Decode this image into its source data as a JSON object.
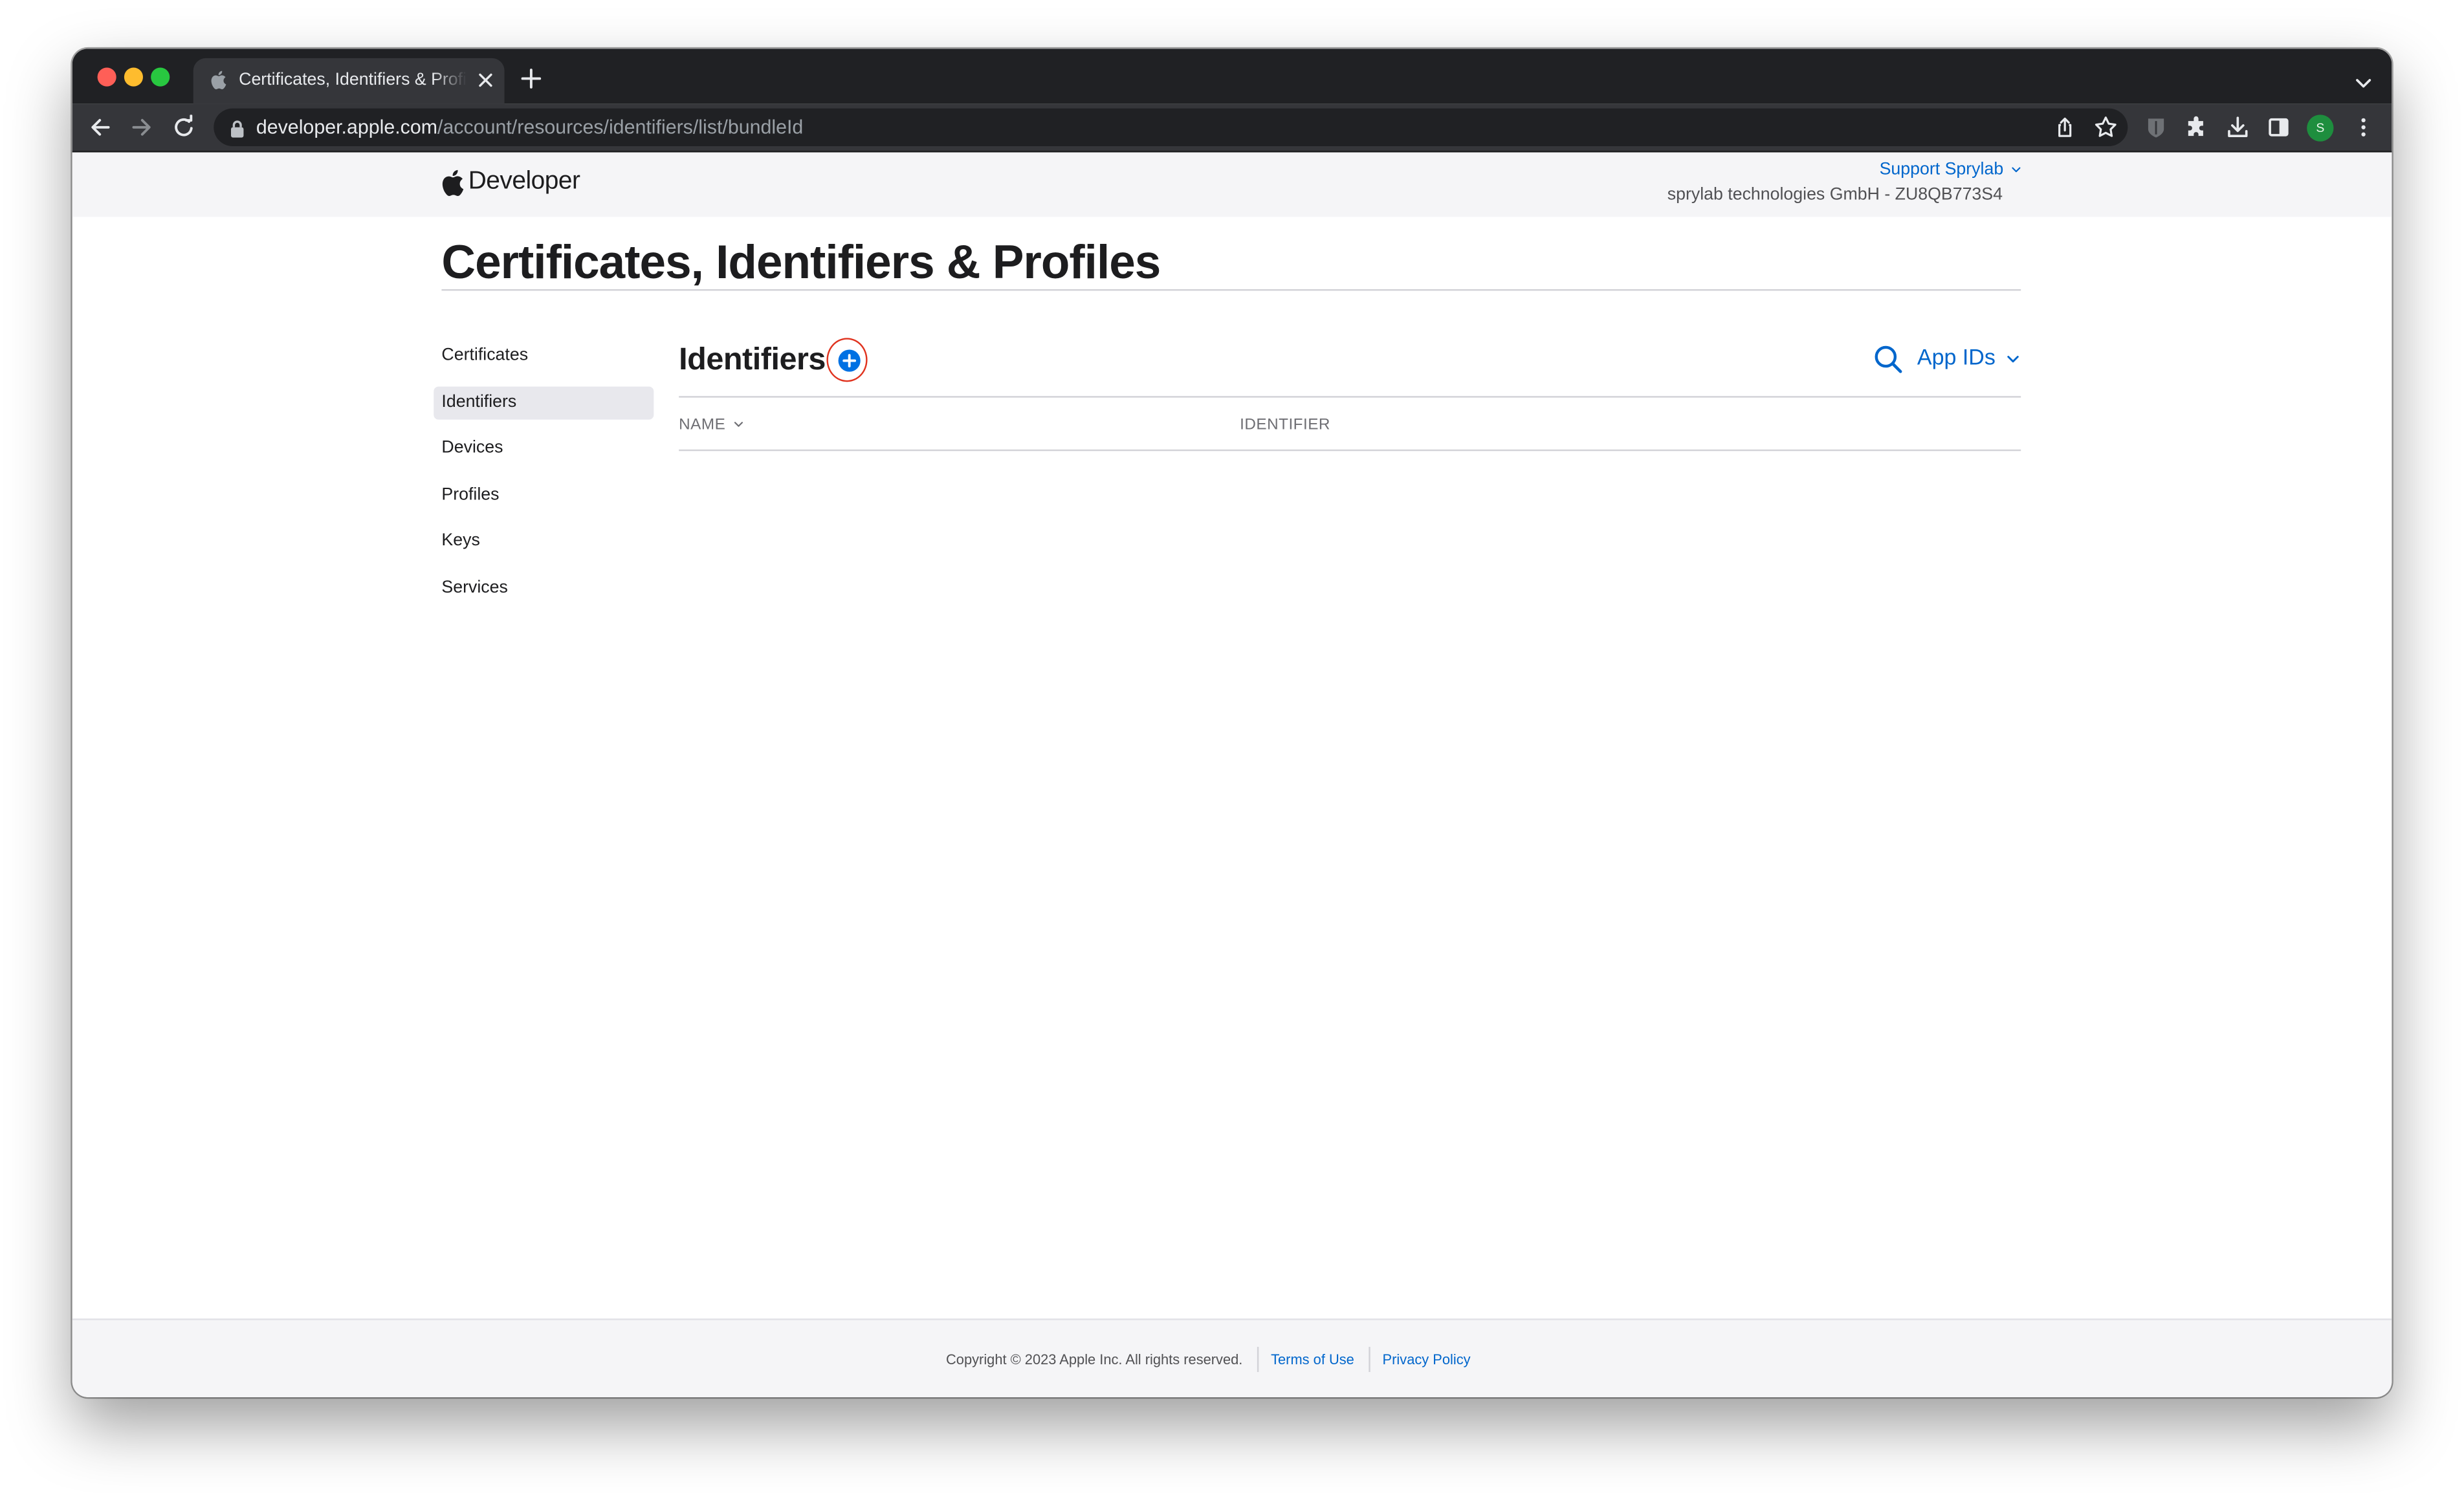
{
  "browser": {
    "tab_title": "Certificates, Identifiers & Profiles",
    "url_host": "developer.apple.com",
    "url_path": "/account/resources/identifiers/list/bundleId",
    "profile_initial": "S"
  },
  "globalnav": {
    "brand": "Developer",
    "account_menu": "Support Sprylab",
    "team": "sprylab technologies GmbH - ZU8QB773S4"
  },
  "page": {
    "title": "Certificates, Identifiers & Profiles"
  },
  "sidebar": {
    "items": [
      {
        "label": "Certificates"
      },
      {
        "label": "Identifiers"
      },
      {
        "label": "Devices"
      },
      {
        "label": "Profiles"
      },
      {
        "label": "Keys"
      },
      {
        "label": "Services"
      }
    ],
    "active": "Identifiers"
  },
  "section": {
    "title": "Identifiers",
    "filter": "App IDs"
  },
  "table": {
    "columns": [
      "NAME",
      "IDENTIFIER"
    ],
    "rows": []
  },
  "footer": {
    "copyright": "Copyright © 2023 Apple Inc. All rights reserved.",
    "links": [
      "Terms of Use",
      "Privacy Policy"
    ]
  },
  "colors": {
    "accent": "#0066cc",
    "highlight_ring": "#e0331f",
    "chrome_dark": "#202124"
  }
}
